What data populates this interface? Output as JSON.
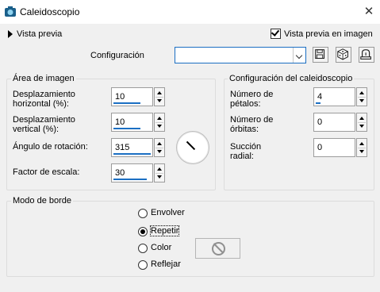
{
  "window": {
    "title": "Caleidoscopio",
    "close_glyph": "✕"
  },
  "preview": {
    "label": "Vista previa",
    "show_preview_label": "Vista previa en imagen",
    "show_preview_checked": true
  },
  "config": {
    "label": "Configuración",
    "value": ""
  },
  "image_area": {
    "legend": "Área de imagen",
    "fields": [
      {
        "label_l1": "Desplazamiento",
        "label_l2": "horizontal (%):",
        "value": "10",
        "level": 0.7
      },
      {
        "label_l1": "Desplazamiento",
        "label_l2": "vertical (%):",
        "value": "10",
        "level": 0.7
      },
      {
        "label_l1": "Ángulo de rotación:",
        "label_l2": "",
        "value": "315",
        "level": 0.95
      },
      {
        "label_l1": "Factor de escala:",
        "label_l2": "",
        "value": "30",
        "level": 0.85
      }
    ]
  },
  "kaleido": {
    "legend": "Configuración del caleidoscopio",
    "fields": [
      {
        "label_l1": "Número de",
        "label_l2": "pétalos:",
        "value": "4",
        "level": 0.12
      },
      {
        "label_l1": "Número de",
        "label_l2": "órbitas:",
        "value": "0",
        "level": 0
      },
      {
        "label_l1": "Succión",
        "label_l2": "radial:",
        "value": "0",
        "level": 0
      }
    ]
  },
  "border_mode": {
    "legend": "Modo de borde",
    "options": [
      {
        "label": "Envolver",
        "selected": false
      },
      {
        "label": "Repetir",
        "selected": true
      },
      {
        "label": "Color",
        "selected": false
      },
      {
        "label": "Reflejar",
        "selected": false
      }
    ]
  },
  "colors": {
    "accent": "#1b6fc3",
    "background": "#f0f0f0"
  },
  "icons": [
    "app-icon",
    "close-icon",
    "expand-arrow-icon",
    "save-icon",
    "dice-icon",
    "delete-preset-icon",
    "no-color-icon"
  ]
}
